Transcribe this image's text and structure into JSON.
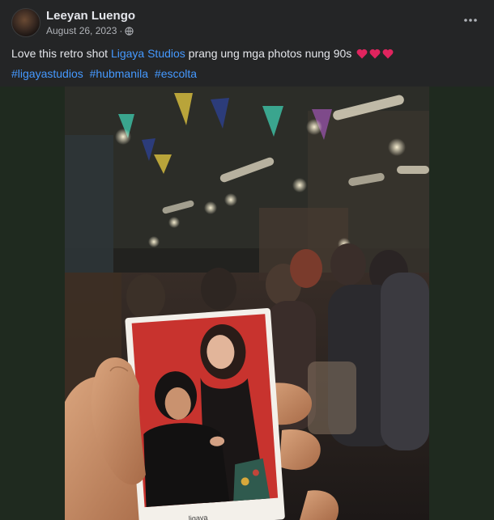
{
  "post": {
    "author": "Leeyan Luengo",
    "date": "August 26, 2023",
    "text_before_link": "Love this retro shot ",
    "tagged_page": "Ligaya Studios",
    "text_after_link": " prang ung mga photos nung 90s",
    "hashtags": [
      "#ligayastudios",
      "#hubmanila",
      "#escolta"
    ],
    "photo_card_caption": "ligaya"
  },
  "icons": {
    "privacy": "globe-icon",
    "menu": "more-horizontal-icon",
    "emoji": "red-heart-icon"
  },
  "colors": {
    "background": "#242526",
    "link": "#4599ff",
    "heart": "#e0245e",
    "media_letterbox": "#1f2a1f",
    "polaroid_backdrop": "#c8332e"
  }
}
